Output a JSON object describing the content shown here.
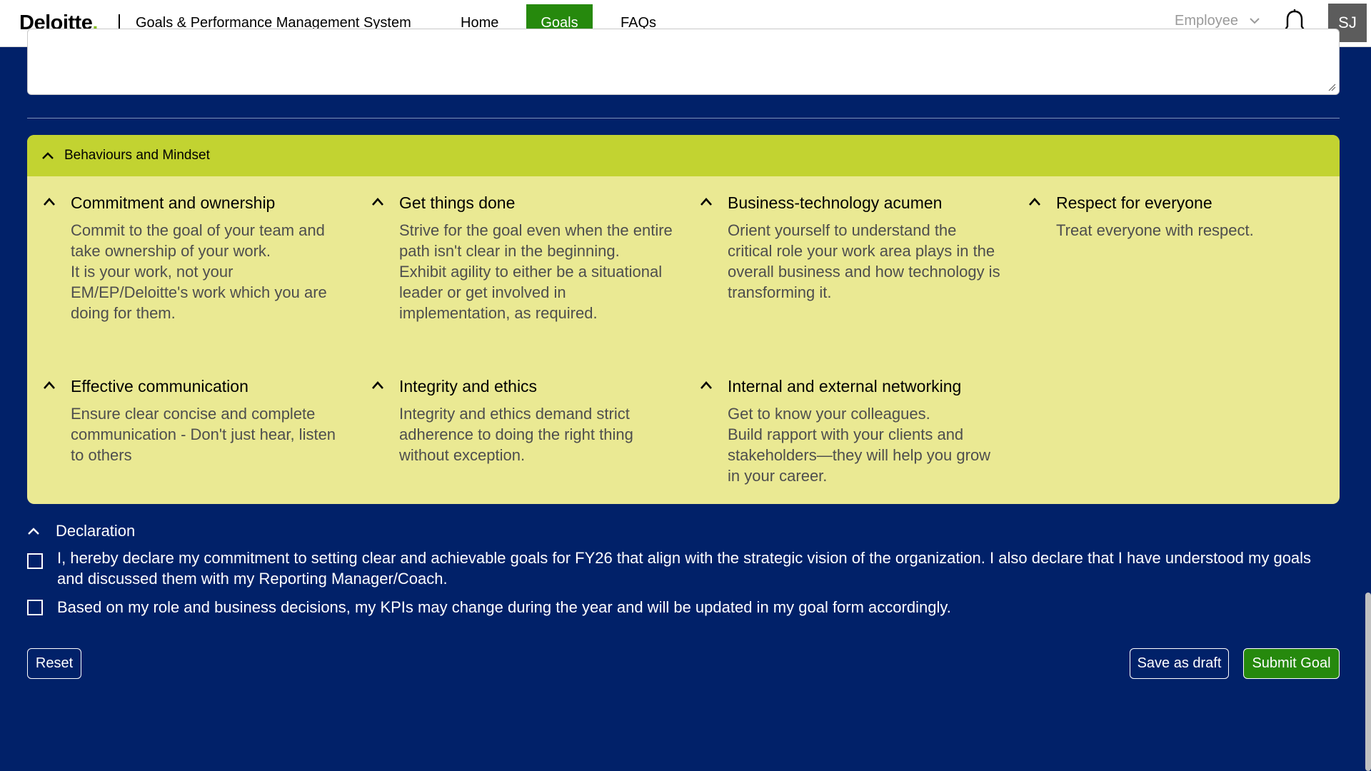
{
  "header": {
    "logo_text": "Deloitte",
    "logo_dot": ".",
    "app_title": "Goals & Performance Management System",
    "nav": {
      "home": "Home",
      "goals": "Goals",
      "faqs": "FAQs"
    },
    "role_selected": "Employee",
    "avatar_initials": "SJ",
    "active_color": "#26890d"
  },
  "behaviours": {
    "section_title": "Behaviours and Mindset",
    "cards": [
      {
        "title": "Commitment and ownership",
        "lines": [
          "Commit to the goal of your team and take ownership of your work.",
          "It is your work, not your EM/EP/Deloitte's work which you are doing for them."
        ]
      },
      {
        "title": "Get things done",
        "lines": [
          "Strive for the goal even when the entire path isn't clear in the beginning.",
          "Exhibit agility to either be a situational leader or get involved in implementation, as required."
        ]
      },
      {
        "title": "Business-technology acumen",
        "lines": [
          "Orient yourself to understand the critical role your work area plays in the overall business and how technology is transforming it."
        ]
      },
      {
        "title": "Respect for everyone",
        "lines": [
          "Treat everyone with respect."
        ]
      },
      {
        "title": "Effective communication",
        "lines": [
          "Ensure clear concise and complete communication - Don't just hear, listen to others"
        ]
      },
      {
        "title": "Integrity and ethics",
        "lines": [
          "Integrity and ethics demand strict adherence to doing the right thing without exception."
        ]
      },
      {
        "title": "Internal and external networking",
        "lines": [
          "Get to know your colleagues.",
          "Build rapport with your clients and stakeholders—they will help you grow in your career."
        ]
      }
    ]
  },
  "declaration": {
    "title": "Declaration",
    "items": [
      "I, hereby declare my commitment to setting clear and achievable goals for FY26 that align with the strategic vision of the organization. I also declare that I have understood my goals and discussed them with my Reporting Manager/Coach.",
      "Based on my role and business decisions, my KPIs may change during the year and will be updated in my goal form accordingly."
    ]
  },
  "actions": {
    "reset": "Reset",
    "save_draft": "Save as draft",
    "submit": "Submit Goal"
  }
}
